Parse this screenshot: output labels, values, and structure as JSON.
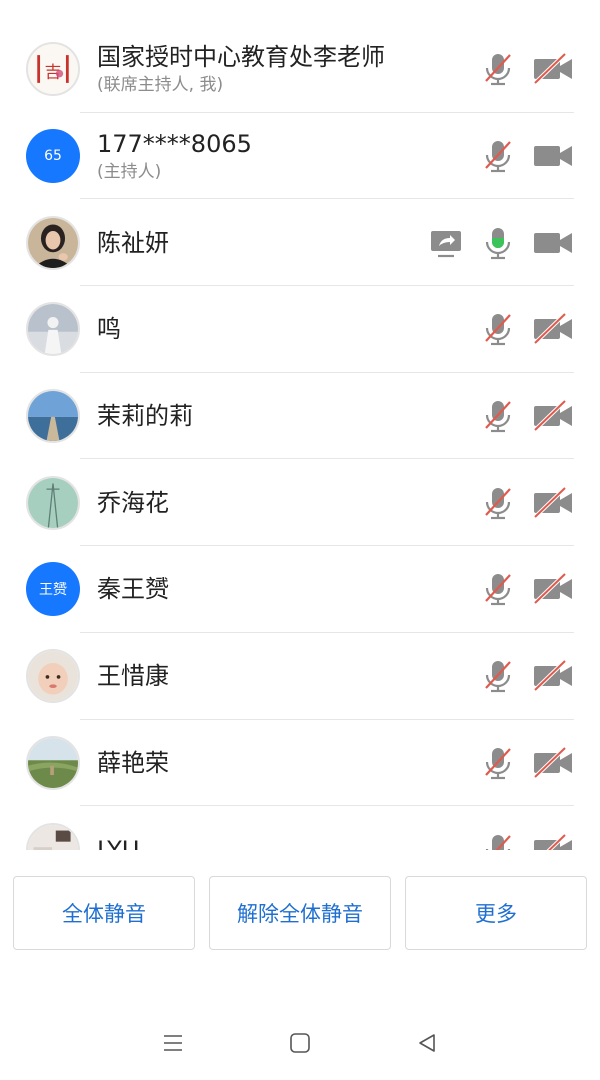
{
  "participants": [
    {
      "name": "国家授时中心教育处李老师",
      "role": "(联席主持人, 我)",
      "avatar": "photo-icon-logo",
      "mic": "muted",
      "cam": "off"
    },
    {
      "name": "177****8065",
      "role": "(主持人)",
      "avatar_text": "65",
      "avatar_color": "#1677ff",
      "mic": "muted",
      "cam": "on"
    },
    {
      "name": "陈祉妍",
      "role": "",
      "avatar": "photo-portrait",
      "share": true,
      "mic": "active",
      "cam": "on"
    },
    {
      "name": "鸣",
      "role": "",
      "avatar": "photo-figure",
      "mic": "muted",
      "cam": "off"
    },
    {
      "name": "茉莉的莉",
      "role": "",
      "avatar": "photo-pier",
      "mic": "muted",
      "cam": "off"
    },
    {
      "name": "乔海花",
      "role": "",
      "avatar": "photo-tower",
      "mic": "muted",
      "cam": "off"
    },
    {
      "name": "秦王赟",
      "role": "",
      "avatar_text": "王赟",
      "avatar_color": "#1677ff",
      "mic": "muted",
      "cam": "off"
    },
    {
      "name": "王惜康",
      "role": "",
      "avatar": "photo-baby",
      "mic": "muted",
      "cam": "off"
    },
    {
      "name": "薛艳荣",
      "role": "",
      "avatar": "photo-landscape",
      "mic": "muted",
      "cam": "off"
    },
    {
      "name": "LYU",
      "role": "",
      "avatar": "photo-room",
      "mic": "muted",
      "cam": "off"
    }
  ],
  "actions": {
    "mute_all": "全体静音",
    "unmute_all": "解除全体静音",
    "more": "更多"
  },
  "colors": {
    "accent": "#1f6fd1",
    "muted_slash": "#e05a4e",
    "mic_active": "#3cc45a",
    "icon_gray": "#8c8c8c"
  }
}
